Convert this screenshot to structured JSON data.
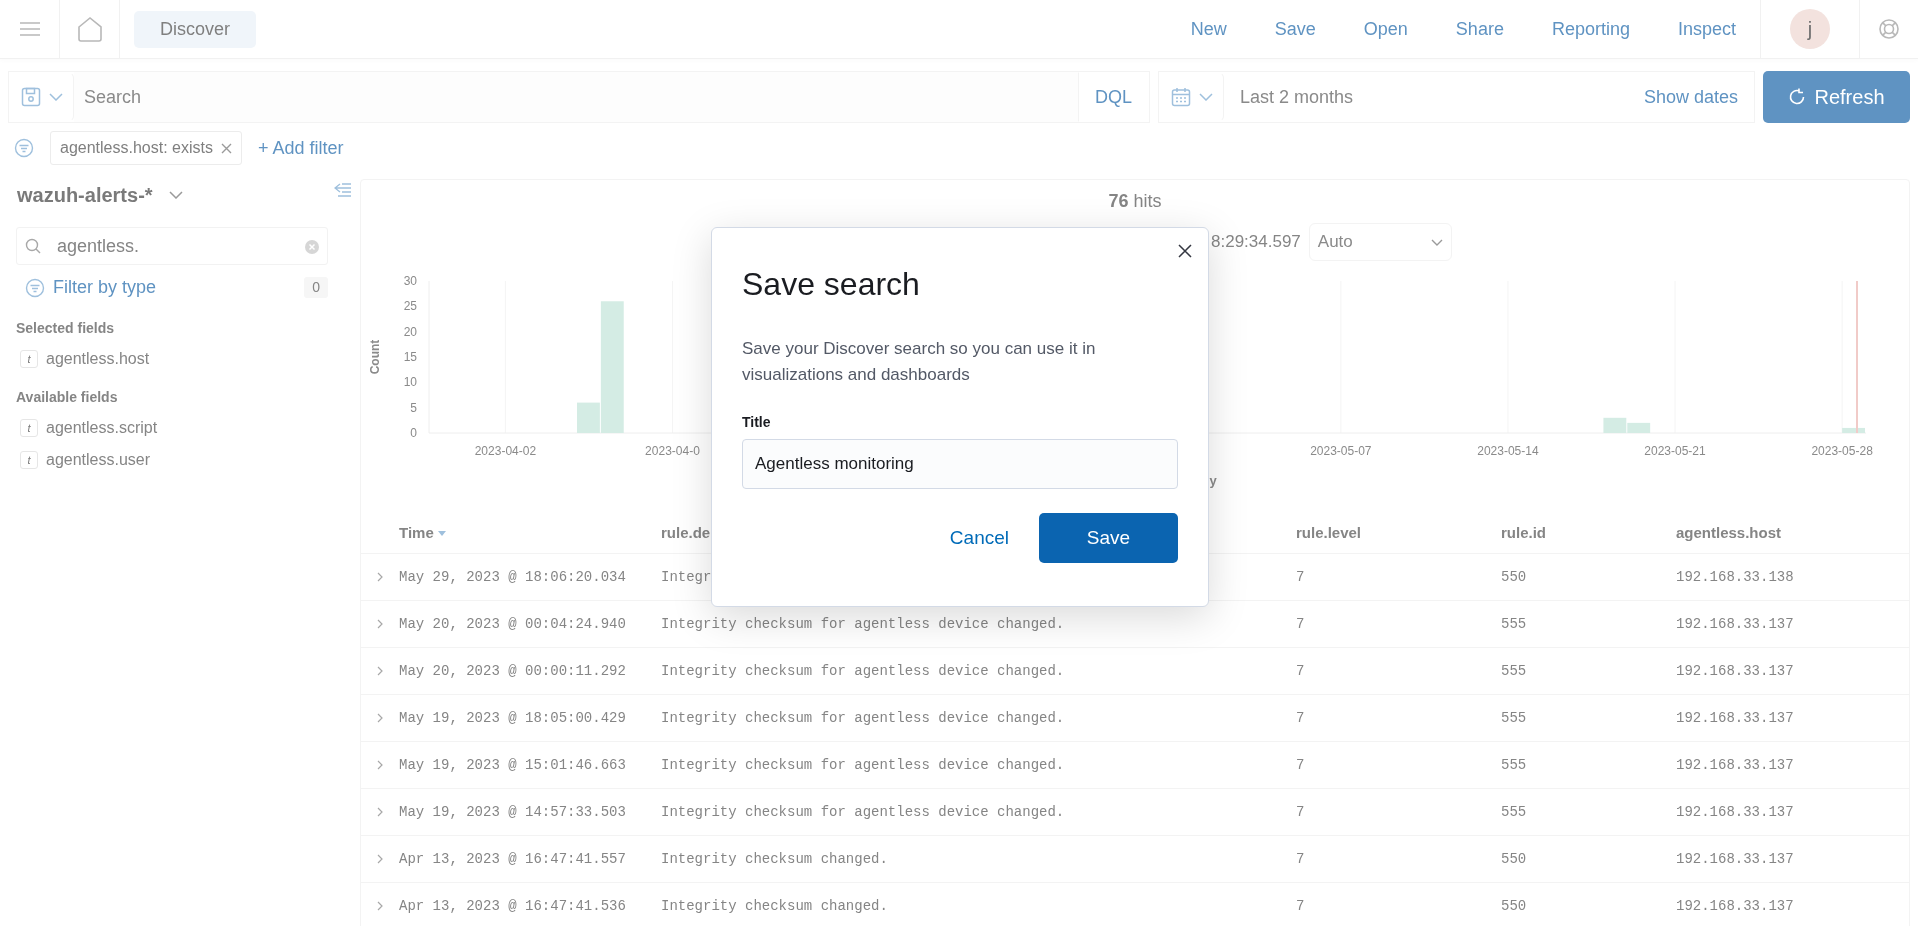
{
  "header": {
    "breadcrumb": "Discover",
    "menu": [
      "New",
      "Save",
      "Open",
      "Share",
      "Reporting",
      "Inspect"
    ],
    "avatar": "j"
  },
  "query": {
    "placeholder": "Search",
    "language": "DQL",
    "date_range": "Last 2 months",
    "show_dates": "Show dates",
    "refresh": "Refresh"
  },
  "filters": [
    {
      "label": "agentless.host: exists"
    }
  ],
  "add_filter": "+ Add filter",
  "sidebar": {
    "index_pattern": "wazuh-alerts-*",
    "field_search": "agentless.",
    "filter_by_type": "Filter by type",
    "filter_count": "0",
    "sections": [
      {
        "title": "Selected fields",
        "fields": [
          {
            "type": "t",
            "name": "agentless.host"
          }
        ]
      },
      {
        "title": "Available fields",
        "fields": [
          {
            "type": "t",
            "name": "agentless.script"
          },
          {
            "type": "t",
            "name": "agentless.user"
          }
        ]
      }
    ]
  },
  "results": {
    "hits_count": "76",
    "hits_label": "hits",
    "time_range": "8:29:34.597",
    "interval": "Auto",
    "chart_data": {
      "type": "bar",
      "grid": true,
      "ylabel": "Count",
      "xlabel": "y",
      "ylim": [
        0,
        30
      ],
      "yticks": [
        0,
        5,
        10,
        15,
        20,
        25,
        30
      ],
      "categories": [
        null,
        null,
        null,
        "2023-04-02",
        null,
        null,
        null,
        null,
        null,
        null,
        "2023-04-0",
        null,
        null,
        null,
        null,
        null,
        null,
        null,
        null,
        null,
        null,
        null,
        null,
        null,
        null,
        null,
        null,
        null,
        null,
        null,
        null,
        null,
        null,
        null,
        null,
        null,
        null,
        null,
        "2023-05-07",
        null,
        null,
        null,
        null,
        null,
        null,
        "2023-05-14",
        null,
        null,
        null,
        null,
        null,
        null,
        "2023-05-21",
        null,
        null,
        null,
        null,
        null,
        null,
        "2023-05-28"
      ],
      "values": [
        null,
        null,
        null,
        null,
        null,
        null,
        6,
        26,
        null,
        null,
        null,
        null,
        null,
        null,
        null,
        null,
        null,
        null,
        null,
        null,
        null,
        null,
        null,
        null,
        null,
        null,
        null,
        null,
        null,
        null,
        null,
        null,
        null,
        null,
        null,
        null,
        null,
        null,
        null,
        null,
        null,
        null,
        null,
        null,
        null,
        null,
        null,
        null,
        null,
        3,
        2,
        null,
        null,
        null,
        null,
        null,
        null,
        null,
        null,
        1
      ]
    },
    "table": {
      "columns": [
        "Time",
        "rule.de",
        "rule.level",
        "rule.id",
        "agentless.host"
      ],
      "rows": [
        [
          "May 29, 2023 @ 18:06:20.034",
          "Integr",
          "7",
          "550",
          "192.168.33.138"
        ],
        [
          "May 20, 2023 @ 00:04:24.940",
          "Integrity checksum for agentless device changed.",
          "7",
          "555",
          "192.168.33.137"
        ],
        [
          "May 20, 2023 @ 00:00:11.292",
          "Integrity checksum for agentless device changed.",
          "7",
          "555",
          "192.168.33.137"
        ],
        [
          "May 19, 2023 @ 18:05:00.429",
          "Integrity checksum for agentless device changed.",
          "7",
          "555",
          "192.168.33.137"
        ],
        [
          "May 19, 2023 @ 15:01:46.663",
          "Integrity checksum for agentless device changed.",
          "7",
          "555",
          "192.168.33.137"
        ],
        [
          "May 19, 2023 @ 14:57:33.503",
          "Integrity checksum for agentless device changed.",
          "7",
          "555",
          "192.168.33.137"
        ],
        [
          "Apr 13, 2023 @ 16:47:41.557",
          "Integrity checksum changed.",
          "7",
          "550",
          "192.168.33.137"
        ],
        [
          "Apr 13, 2023 @ 16:47:41.536",
          "Integrity checksum changed.",
          "7",
          "550",
          "192.168.33.137"
        ]
      ]
    }
  },
  "modal": {
    "title": "Save search",
    "description": "Save your Discover search so you can use it in visualizations and dashboards",
    "field_label": "Title",
    "value": "Agentless monitoring",
    "buttons": [
      {
        "label": "Cancel",
        "kind": "link"
      },
      {
        "label": "Save",
        "kind": "primary"
      }
    ]
  }
}
